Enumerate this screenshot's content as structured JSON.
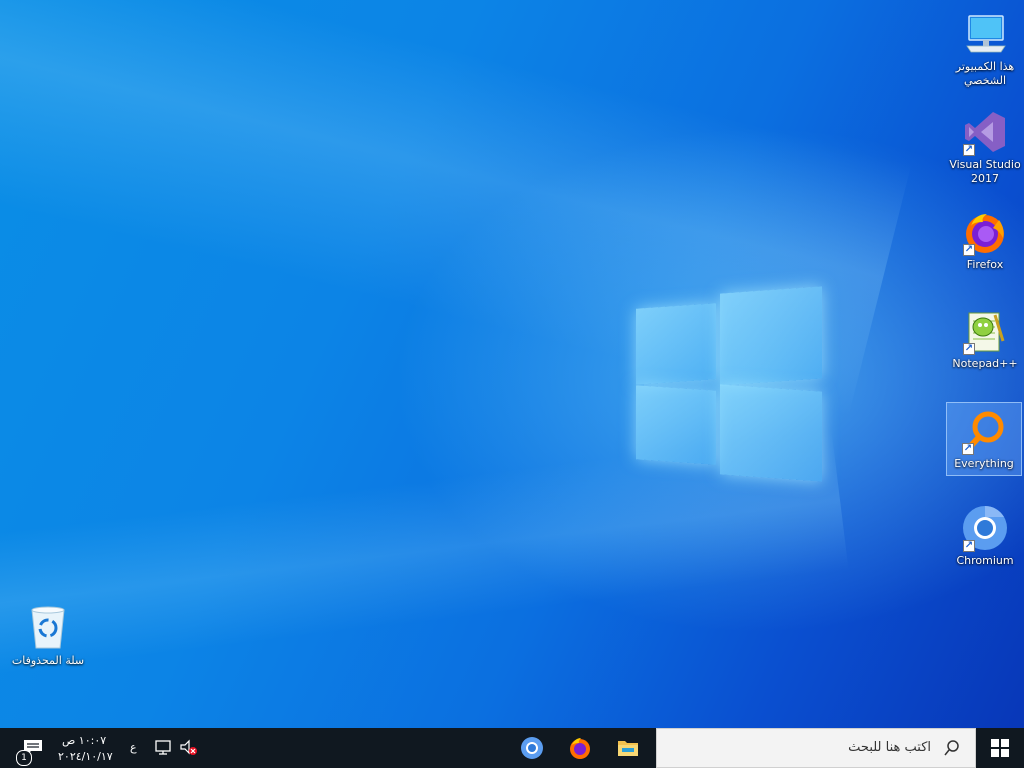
{
  "desktop": {
    "icons": [
      {
        "label": "هذا الكمبيوتر الشخصي",
        "icon": "this-pc-icon"
      },
      {
        "label": "Visual Studio 2017",
        "icon": "visual-studio-icon"
      },
      {
        "label": "Firefox",
        "icon": "firefox-icon"
      },
      {
        "label": "Notepad++",
        "icon": "notepadpp-icon"
      },
      {
        "label": "Everything",
        "icon": "everything-search-icon",
        "selected": true
      },
      {
        "label": "Chromium",
        "icon": "chromium-icon"
      },
      {
        "label": "سلة المحذوفات",
        "icon": "recycle-bin-icon"
      }
    ]
  },
  "taskbar": {
    "search_placeholder": "اكتب هنا للبحث",
    "pinned": [
      "file-explorer-icon",
      "firefox-icon",
      "chromium-icon"
    ],
    "tray": {
      "time": "١٠:٠٧ ص",
      "date": "٢٠٢٤/١٠/١٧",
      "input_indicator": "ع",
      "notification_count": "1"
    }
  },
  "colors": {
    "taskbar_bg": "#101820",
    "search_bg": "#f3f3f3",
    "selection": "#78b4ff"
  }
}
